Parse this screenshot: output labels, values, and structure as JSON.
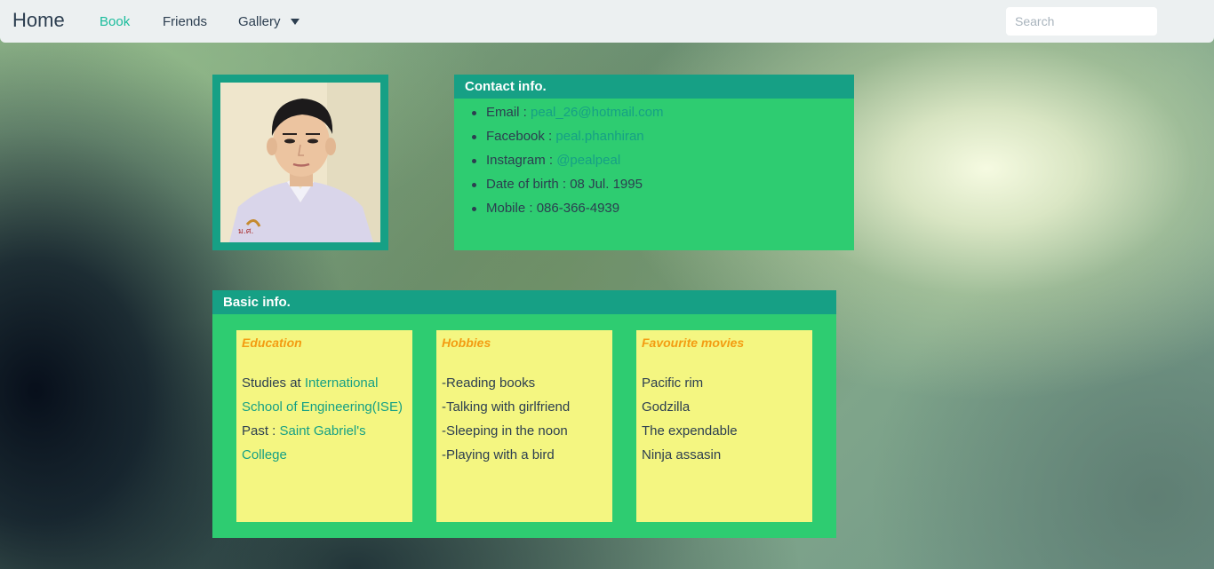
{
  "navbar": {
    "brand": "Home",
    "links": [
      "Book",
      "Friends",
      "Gallery"
    ],
    "search_placeholder": "Search"
  },
  "contact": {
    "title": "Contact info.",
    "items": [
      {
        "label": "Email : ",
        "value": "peal_26@hotmail.com"
      },
      {
        "label": "Facebook : ",
        "value": "peal.phanhiran"
      },
      {
        "label": "Instagram : ",
        "value": "@pealpeal"
      },
      {
        "label": "Date of birth : ",
        "value": "08 Jul. 1995"
      },
      {
        "label": "Mobile : ",
        "value": "086-366-4939"
      }
    ]
  },
  "basic": {
    "title": "Basic info.",
    "education": {
      "title": "Education",
      "studies_prefix": "Studies at ",
      "studies_line1": "International",
      "studies_line2": "School of Engineering(ISE)",
      "past_prefix": "Past : ",
      "past_line1": "Saint Gabriel's",
      "past_line2": "College"
    },
    "hobbies": {
      "title": "Hobbies",
      "items": [
        "-Reading books",
        "-Talking with girlfriend",
        "-Sleeping in the noon",
        "-Playing with a bird"
      ]
    },
    "movies": {
      "title": "Favourite movies",
      "items": [
        "Pacific rim",
        "Godzilla",
        "The expendable",
        "Ninja assasin"
      ]
    }
  },
  "colors": {
    "accent": "#1abc9c",
    "dark_teal": "#16a085",
    "green": "#2ecc71",
    "card": "#f4f681",
    "card_title": "#f39c12",
    "text": "#2c3e50"
  },
  "icons": {
    "gallery_dropdown": "caret-down-icon"
  }
}
